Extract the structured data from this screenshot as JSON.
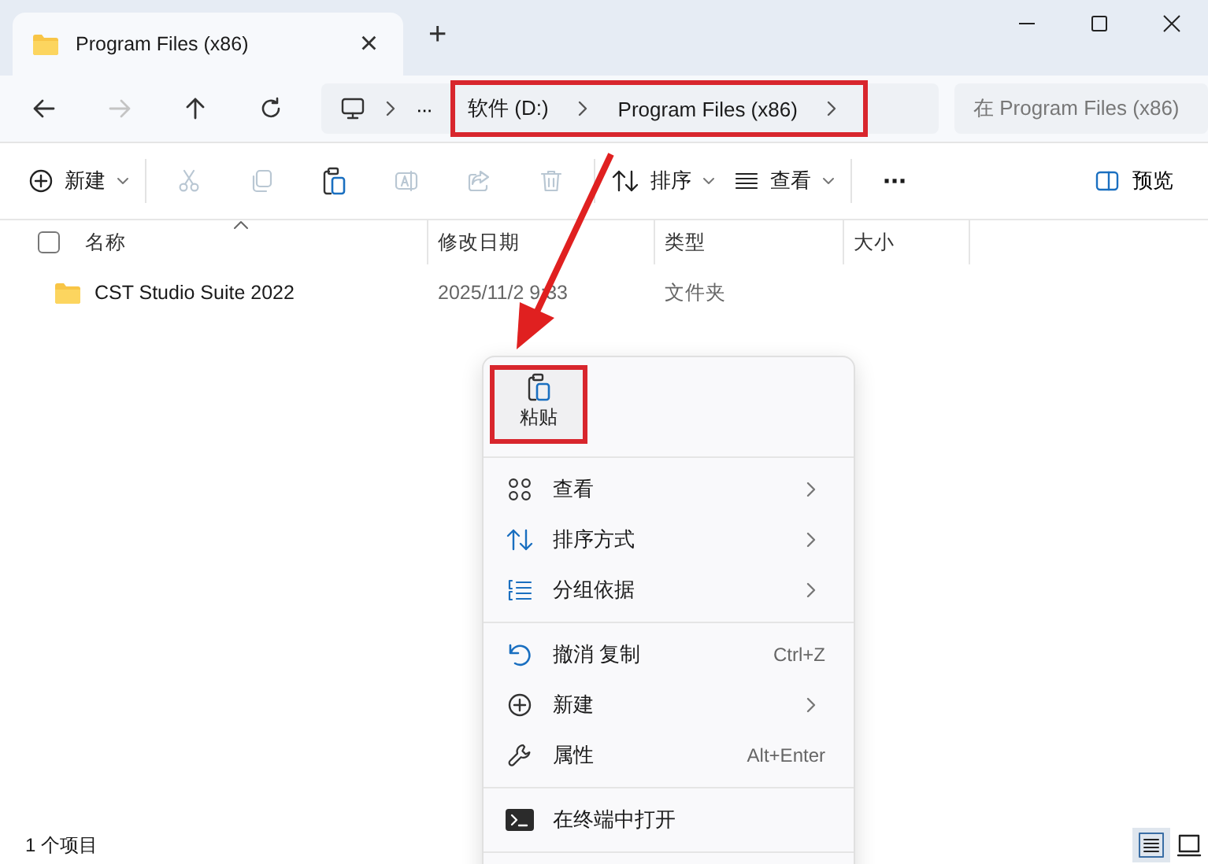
{
  "tab": {
    "title": "Program Files (x86)",
    "close": "×",
    "new_tab": "+"
  },
  "nav": {
    "buttons": [
      {
        "kind": "back",
        "disabled": false
      },
      {
        "kind": "forward",
        "disabled": true
      },
      {
        "kind": "up",
        "disabled": false
      },
      {
        "kind": "refresh",
        "disabled": false
      }
    ],
    "more": "···",
    "breadcrumb_highlighted": true,
    "segments": [
      {
        "label": "软件 (D:)"
      },
      {
        "label": "Program Files (x86)"
      }
    ],
    "search_placeholder": "在 Program Files (x86)"
  },
  "toolbar": [
    {
      "kind": "new",
      "label": "新建",
      "disabled": false,
      "dropdown": true
    },
    {
      "kind": "cut",
      "disabled": true
    },
    {
      "kind": "copy",
      "disabled": true
    },
    {
      "kind": "paste",
      "disabled": false
    },
    {
      "kind": "rename",
      "disabled": true
    },
    {
      "kind": "share",
      "disabled": true
    },
    {
      "kind": "delete",
      "disabled": true
    },
    {
      "kind": "sort",
      "label": "排序",
      "disabled": false,
      "dropdown": true
    },
    {
      "kind": "view",
      "label": "查看",
      "disabled": false,
      "dropdown": true
    },
    {
      "kind": "more",
      "label": "···"
    }
  ],
  "preview": {
    "label": "预览"
  },
  "select_all_checked": false,
  "columns": [
    {
      "label": "名称",
      "sorted": true
    },
    {
      "label": "修改日期",
      "sorted": false
    },
    {
      "label": "类型",
      "sorted": false
    },
    {
      "label": "大小",
      "sorted": false
    }
  ],
  "rows": [
    {
      "name": "CST Studio Suite 2022",
      "modified": "2025/11/2 9:33",
      "type": "文件夹",
      "size": ""
    }
  ],
  "context_menu": {
    "paste": {
      "label": "粘贴",
      "highlighted": true
    },
    "items": [
      {
        "kind": "view",
        "label": "查看",
        "submenu": true
      },
      {
        "kind": "sort",
        "label": "排序方式",
        "submenu": true
      },
      {
        "kind": "group",
        "label": "分组依据",
        "submenu": true
      },
      {
        "kind": "separator"
      },
      {
        "kind": "undo",
        "label": "撤消 复制",
        "shortcut": "Ctrl+Z",
        "submenu": false
      },
      {
        "kind": "new",
        "label": "新建",
        "submenu": true
      },
      {
        "kind": "properties",
        "label": "属性",
        "shortcut": "Alt+Enter",
        "submenu": false
      },
      {
        "kind": "separator"
      },
      {
        "kind": "terminal",
        "label": "在终端中打开",
        "submenu": false
      },
      {
        "kind": "separator"
      }
    ]
  },
  "status_bar": {
    "count": "1 个项目",
    "views": [
      {
        "kind": "details",
        "selected": true
      },
      {
        "kind": "tiles",
        "selected": false
      }
    ]
  }
}
